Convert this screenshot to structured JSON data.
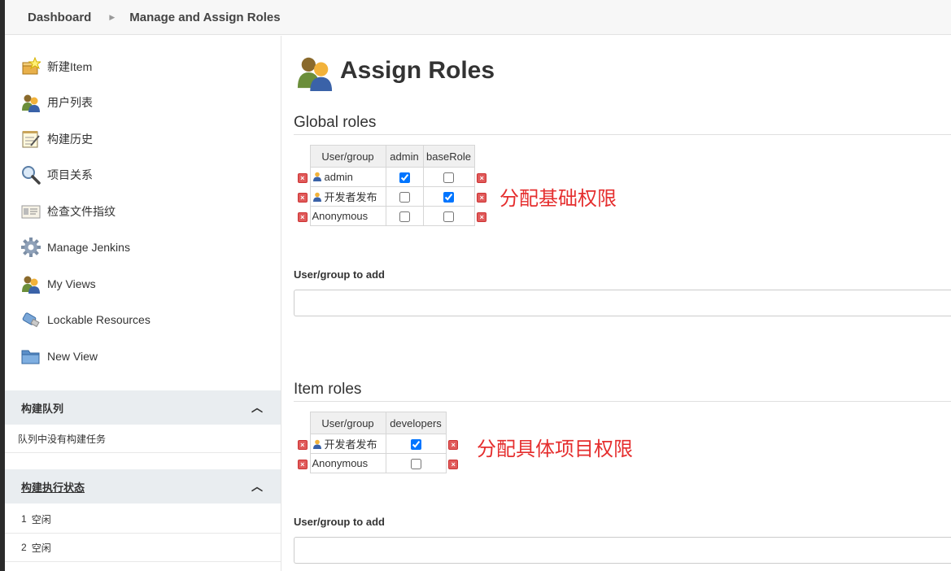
{
  "breadcrumb": {
    "dashboard": "Dashboard",
    "current": "Manage and Assign Roles"
  },
  "sidebar": {
    "items": [
      {
        "label": "新建Item",
        "icon": "new-item-icon"
      },
      {
        "label": "用户列表",
        "icon": "users-icon"
      },
      {
        "label": "构建历史",
        "icon": "notepad-icon"
      },
      {
        "label": "项目关系",
        "icon": "magnifier-icon"
      },
      {
        "label": "检查文件指纹",
        "icon": "fingerprint-card-icon"
      },
      {
        "label": "Manage Jenkins",
        "icon": "gear-icon"
      },
      {
        "label": "My Views",
        "icon": "users-icon"
      },
      {
        "label": "Lockable Resources",
        "icon": "usb-key-icon"
      },
      {
        "label": "New View",
        "icon": "folder-icon"
      }
    ],
    "build_queue": {
      "title": "构建队列",
      "empty_text": "队列中没有构建任务"
    },
    "executor_status": {
      "title": "构建执行状态",
      "rows": [
        {
          "num": "1",
          "status": "空闲"
        },
        {
          "num": "2",
          "status": "空闲"
        }
      ]
    }
  },
  "main": {
    "title": "Assign Roles",
    "global": {
      "heading": "Global roles",
      "columns": [
        "User/group",
        "admin",
        "baseRole"
      ],
      "rows": [
        {
          "name": "admin",
          "is_user": true,
          "checks": [
            true,
            false
          ]
        },
        {
          "name": "开发者发布",
          "is_user": true,
          "checks": [
            false,
            true
          ]
        },
        {
          "name": "Anonymous",
          "is_user": false,
          "checks": [
            false,
            false
          ]
        }
      ],
      "annotation": "分配基础权限",
      "add_label": "User/group to add",
      "add_value": ""
    },
    "item": {
      "heading": "Item roles",
      "columns": [
        "User/group",
        "developers"
      ],
      "rows": [
        {
          "name": "开发者发布",
          "is_user": true,
          "checks": [
            true
          ]
        },
        {
          "name": "Anonymous",
          "is_user": false,
          "checks": [
            false
          ]
        }
      ],
      "annotation": "分配具体项目权限",
      "add_label": "User/group to add",
      "add_value": ""
    }
  },
  "colors": {
    "annotation_red": "#e52e2e",
    "panel_bg": "#e9edf0",
    "delete_red": "#e05a5a"
  }
}
